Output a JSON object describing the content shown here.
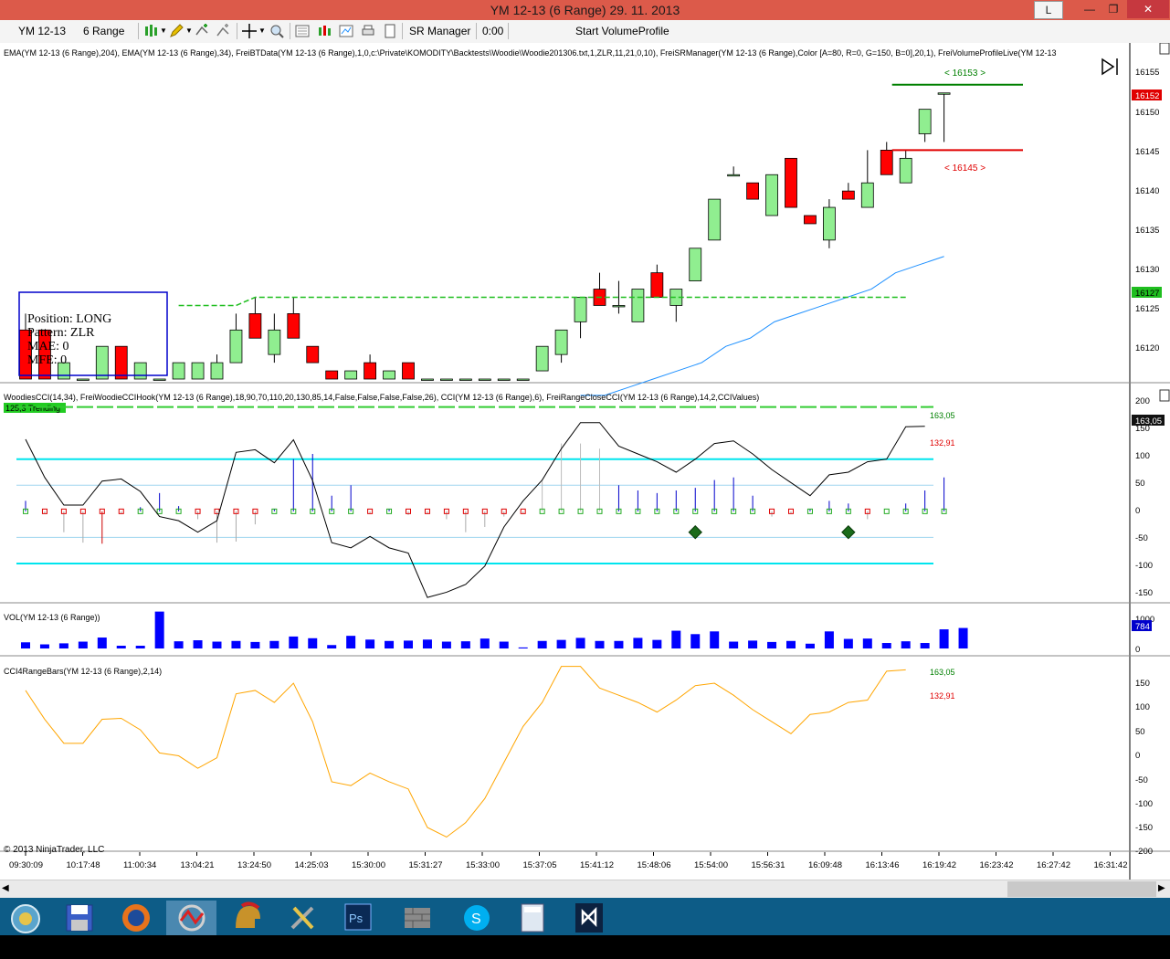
{
  "window": {
    "title": "YM 12-13 (6 Range)  29. 11. 2013",
    "btn_l": "L",
    "btn_min": "—",
    "btn_max": "❐",
    "btn_close": "✕"
  },
  "toolbar": {
    "instrument": "YM 12-13",
    "period": "6 Range",
    "sr_manager": "SR Manager",
    "time": "0:00",
    "start_vp": "Start VolumeProfile",
    "icons": [
      "bar-type-icon",
      "pencil-icon",
      "add-indicator-icon",
      "strategies-icon",
      "crosshair-icon",
      "zoom-icon",
      "data-box-icon",
      "chart-style-icon",
      "properties-icon",
      "print-icon"
    ]
  },
  "panels": {
    "price_label": "EMA(YM  12-13  (6  Range),204),  EMA(YM  12-13  (6  Range),34),  FreiBTData(YM  12-13  (6  Range),1,0,c:\\Private\\KOMODITY\\Backtests\\Woodie\\Woodie201306.txt,1,ZLR,11,21,0,10),  FreiSRManager(YM  12-13  (6  Range),Color  [A=80,  R=0,  G=150,  B=0],20,1),  FreiVolumeProfileLive(YM  12-13",
    "cci_label": "WoodiesCCI(14,34),  FreiWoodieCCIHook(YM  12-13  (6  Range),18,90,70,110,20,130,85,14,False,False,False,False,26),  CCI(YM  12-13  (6  Range),6),  FreiRangeCloseCCI(YM  12-13  (6  Range),14,2,CCIValues)",
    "trending_badge": "125,3  Trending",
    "vol_label": "VOL(YM 12-13 (6 Range))",
    "cci4_label": "CCI4RangeBars(YM 12-13 (6 Range),2,14)",
    "copyright": "© 2013 NinjaTrader, LLC"
  },
  "position_box": {
    "line1": "Position: LONG",
    "line2": "Pattern: ZLR",
    "line3": "MAE: 0",
    "line4": "MFE: 0"
  },
  "sr_levels": {
    "upper": "< 16153 >",
    "lower": "< 16145 >",
    "upper_color": "#008000",
    "lower_color": "#e00000"
  },
  "price_axis": {
    "ticks": [
      "16155",
      "16150",
      "16145",
      "16140",
      "16135",
      "16130",
      "16125",
      "16120"
    ],
    "last_price": "16152",
    "ema_marker": "16127",
    "last_price_color": "#e00000",
    "ema_marker_color": "#1fbe1f"
  },
  "cci_axis": {
    "ticks": [
      "200",
      "150",
      "100",
      "50",
      "0",
      "-50",
      "-100",
      "-150"
    ],
    "value_marker": "163,05",
    "value_up": "163,05",
    "value_down": "132,91"
  },
  "vol_axis": {
    "ticks": [
      "1000",
      "0"
    ],
    "marker": "784"
  },
  "cci4_axis": {
    "ticks": [
      "150",
      "100",
      "50",
      "0",
      "-50",
      "-100",
      "-150",
      "-200"
    ],
    "value_up": "163,05",
    "value_down": "132,91"
  },
  "time_axis": {
    "labels": [
      "09:30:09",
      "10:17:48",
      "11:00:34",
      "13:04:21",
      "13:24:50",
      "14:25:03",
      "15:30:00",
      "15:31:27",
      "15:33:00",
      "15:37:05",
      "15:41:12",
      "15:48:06",
      "15:54:00",
      "15:56:31",
      "16:09:48",
      "16:13:46",
      "16:19:42",
      "16:23:42",
      "16:27:42",
      "16:31:42"
    ]
  },
  "colors": {
    "bull": "#90ee90",
    "bear": "#ff0000",
    "ema34": "#1e90ff",
    "cci4": "#ffa500",
    "volume": "#0000ff",
    "titlebar": "#dc5a4a",
    "taskbar": "#0d5c87"
  },
  "chart_data": {
    "type": "candlestick",
    "candles": [
      {
        "o": 16123,
        "c": 16117,
        "h": 16125,
        "l": 16117
      },
      {
        "o": 16123,
        "c": 16117,
        "h": 16123,
        "l": 16117
      },
      {
        "o": 16117,
        "c": 16119,
        "h": 16119,
        "l": 16117
      },
      {
        "o": 16117,
        "c": 16117,
        "h": 16117,
        "l": 16117
      },
      {
        "o": 16117,
        "c": 16121,
        "h": 16121,
        "l": 16117
      },
      {
        "o": 16121,
        "c": 16117,
        "h": 16121,
        "l": 16117
      },
      {
        "o": 16117,
        "c": 16119,
        "h": 16119,
        "l": 16117
      },
      {
        "o": 16117,
        "c": 16117,
        "h": 16117,
        "l": 16117
      },
      {
        "o": 16117,
        "c": 16119,
        "h": 16119,
        "l": 16117
      },
      {
        "o": 16117,
        "c": 16119,
        "h": 16119,
        "l": 16117
      },
      {
        "o": 16117,
        "c": 16119,
        "h": 16120,
        "l": 16117
      },
      {
        "o": 16119,
        "c": 16123,
        "h": 16125,
        "l": 16119
      },
      {
        "o": 16125,
        "c": 16122,
        "h": 16127,
        "l": 16122
      },
      {
        "o": 16120,
        "c": 16123,
        "h": 16125,
        "l": 16119
      },
      {
        "o": 16125,
        "c": 16122,
        "h": 16127,
        "l": 16122
      },
      {
        "o": 16121,
        "c": 16119,
        "h": 16121,
        "l": 16119
      },
      {
        "o": 16118,
        "c": 16117,
        "h": 16118,
        "l": 16117
      },
      {
        "o": 16117,
        "c": 16118,
        "h": 16118,
        "l": 16117
      },
      {
        "o": 16119,
        "c": 16117,
        "h": 16120,
        "l": 16117
      },
      {
        "o": 16117,
        "c": 16118,
        "h": 16118,
        "l": 16117
      },
      {
        "o": 16119,
        "c": 16117,
        "h": 16119,
        "l": 16117
      },
      {
        "o": 16117,
        "c": 16117,
        "h": 16117,
        "l": 16117
      },
      {
        "o": 16117,
        "c": 16117,
        "h": 16117,
        "l": 16117
      },
      {
        "o": 16117,
        "c": 16117,
        "h": 16117,
        "l": 16117
      },
      {
        "o": 16117,
        "c": 16117,
        "h": 16117,
        "l": 16117
      },
      {
        "o": 16117,
        "c": 16117,
        "h": 16117,
        "l": 16117
      },
      {
        "o": 16117,
        "c": 16117,
        "h": 16117,
        "l": 16117
      },
      {
        "o": 16118,
        "c": 16121,
        "h": 16121,
        "l": 16118
      },
      {
        "o": 16120,
        "c": 16123,
        "h": 16123,
        "l": 16119
      },
      {
        "o": 16124,
        "c": 16127,
        "h": 16127,
        "l": 16122
      },
      {
        "o": 16128,
        "c": 16126,
        "h": 16130,
        "l": 16126
      },
      {
        "o": 16126,
        "c": 16126,
        "h": 16129,
        "l": 16125
      },
      {
        "o": 16124,
        "c": 16128,
        "h": 16128,
        "l": 16124
      },
      {
        "o": 16130,
        "c": 16127,
        "h": 16131,
        "l": 16127
      },
      {
        "o": 16126,
        "c": 16128,
        "h": 16128,
        "l": 16124
      },
      {
        "o": 16129,
        "c": 16133,
        "h": 16133,
        "l": 16129
      },
      {
        "o": 16134,
        "c": 16139,
        "h": 16139,
        "l": 16134
      },
      {
        "o": 16142,
        "c": 16142,
        "h": 16143,
        "l": 16142
      },
      {
        "o": 16141,
        "c": 16139,
        "h": 16141,
        "l": 16139
      },
      {
        "o": 16137,
        "c": 16142,
        "h": 16142,
        "l": 16137
      },
      {
        "o": 16144,
        "c": 16138,
        "h": 16144,
        "l": 16138
      },
      {
        "o": 16137,
        "c": 16136,
        "h": 16137,
        "l": 16136
      },
      {
        "o": 16134,
        "c": 16138,
        "h": 16139,
        "l": 16133
      },
      {
        "o": 16140,
        "c": 16139,
        "h": 16141,
        "l": 16139
      },
      {
        "o": 16138,
        "c": 16141,
        "h": 16145,
        "l": 16138
      },
      {
        "o": 16145,
        "c": 16142,
        "h": 16146,
        "l": 16142
      },
      {
        "o": 16141,
        "c": 16144,
        "h": 16145,
        "l": 16141
      },
      {
        "o": 16147,
        "c": 16150,
        "h": 16150,
        "l": 16146
      },
      {
        "o": 16152,
        "c": 16152,
        "h": 16152,
        "l": 16146
      }
    ],
    "ema34": [
      16115,
      16115,
      16116,
      16117,
      16118,
      16119,
      16121,
      16122,
      16124,
      16125,
      16126,
      16127,
      16128,
      16130,
      16131,
      16132
    ],
    "sr_upper": 16153,
    "sr_lower": 16145,
    "cci": [
      20,
      -5,
      -40,
      -60,
      -62,
      -5,
      8,
      35,
      10,
      -15,
      -60,
      -58,
      -25,
      5,
      100,
      110,
      30,
      50,
      -5,
      5,
      -7,
      -5,
      -15,
      -40,
      -30,
      -10,
      -5,
      60,
      130,
      130,
      120,
      50,
      40,
      35,
      40,
      45,
      60,
      65,
      30,
      -10,
      -5,
      5,
      20,
      15,
      -15,
      0,
      15,
      40,
      65
    ],
    "woodies_cci": [
      138,
      65,
      12,
      12,
      58,
      62,
      38,
      -10,
      -18,
      -40,
      -18,
      113,
      118,
      93,
      137,
      59,
      -60,
      -70,
      -48,
      -70,
      -80,
      -165,
      -155,
      -140,
      -105,
      -30,
      20,
      60,
      120,
      170,
      170,
      125,
      110,
      95,
      75,
      100,
      130,
      135,
      110,
      80,
      55,
      30,
      70,
      75,
      95,
      100,
      162,
      163
    ],
    "volume": [
      180,
      120,
      150,
      200,
      320,
      80,
      80,
      1080,
      210,
      240,
      200,
      220,
      190,
      220,
      350,
      300,
      100,
      370,
      260,
      220,
      230,
      260,
      200,
      210,
      290,
      200,
      30,
      220,
      250,
      310,
      220,
      220,
      310,
      250,
      520,
      420,
      500,
      200,
      230,
      190,
      220,
      140,
      500,
      280,
      290,
      160,
      210,
      160,
      560,
      600
    ],
    "cci4": [
      120,
      60,
      10,
      10,
      60,
      62,
      38,
      -10,
      -16,
      -42,
      -20,
      113,
      120,
      95,
      135,
      55,
      -70,
      -78,
      -52,
      -70,
      -85,
      -165,
      -185,
      -155,
      -105,
      -30,
      45,
      95,
      170,
      170,
      125,
      110,
      95,
      75,
      100,
      130,
      135,
      110,
      80,
      55,
      30,
      70,
      75,
      95,
      100,
      160,
      163
    ],
    "ylim_price": [
      16117,
      16157
    ],
    "ylim_cci": [
      -170,
      215
    ],
    "ylim_cci4": [
      -205,
      175
    ]
  },
  "taskbar": {
    "items": [
      "ninjatrader-start-icon",
      "save-icon",
      "firefox-icon",
      "ninjatrader-icon",
      "spartan-icon",
      "tools-icon",
      "photoshop-icon",
      "firewall-icon",
      "skype-icon",
      "calculator-icon",
      "visual-studio-icon"
    ]
  }
}
